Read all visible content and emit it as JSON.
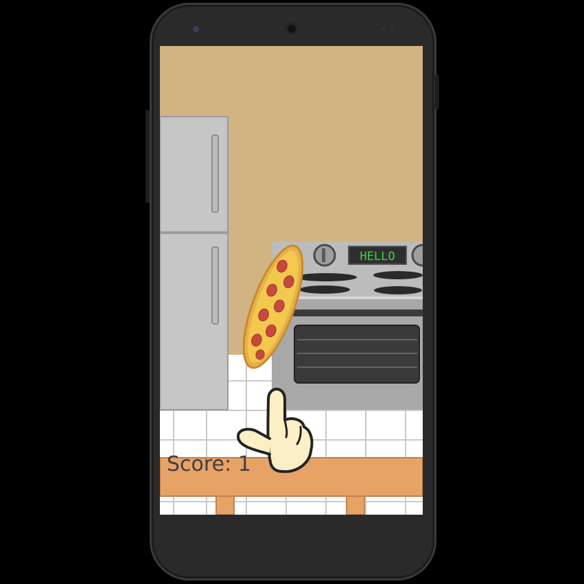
{
  "game": {
    "score_label": "Score:",
    "score_value": "1",
    "stove_display": "HELLO"
  },
  "colors": {
    "wall": "#d2b384",
    "fridge": "#c4c4c4",
    "stove": "#a7a7a7",
    "counter": "#e7a266",
    "display_text": "#41d341"
  }
}
